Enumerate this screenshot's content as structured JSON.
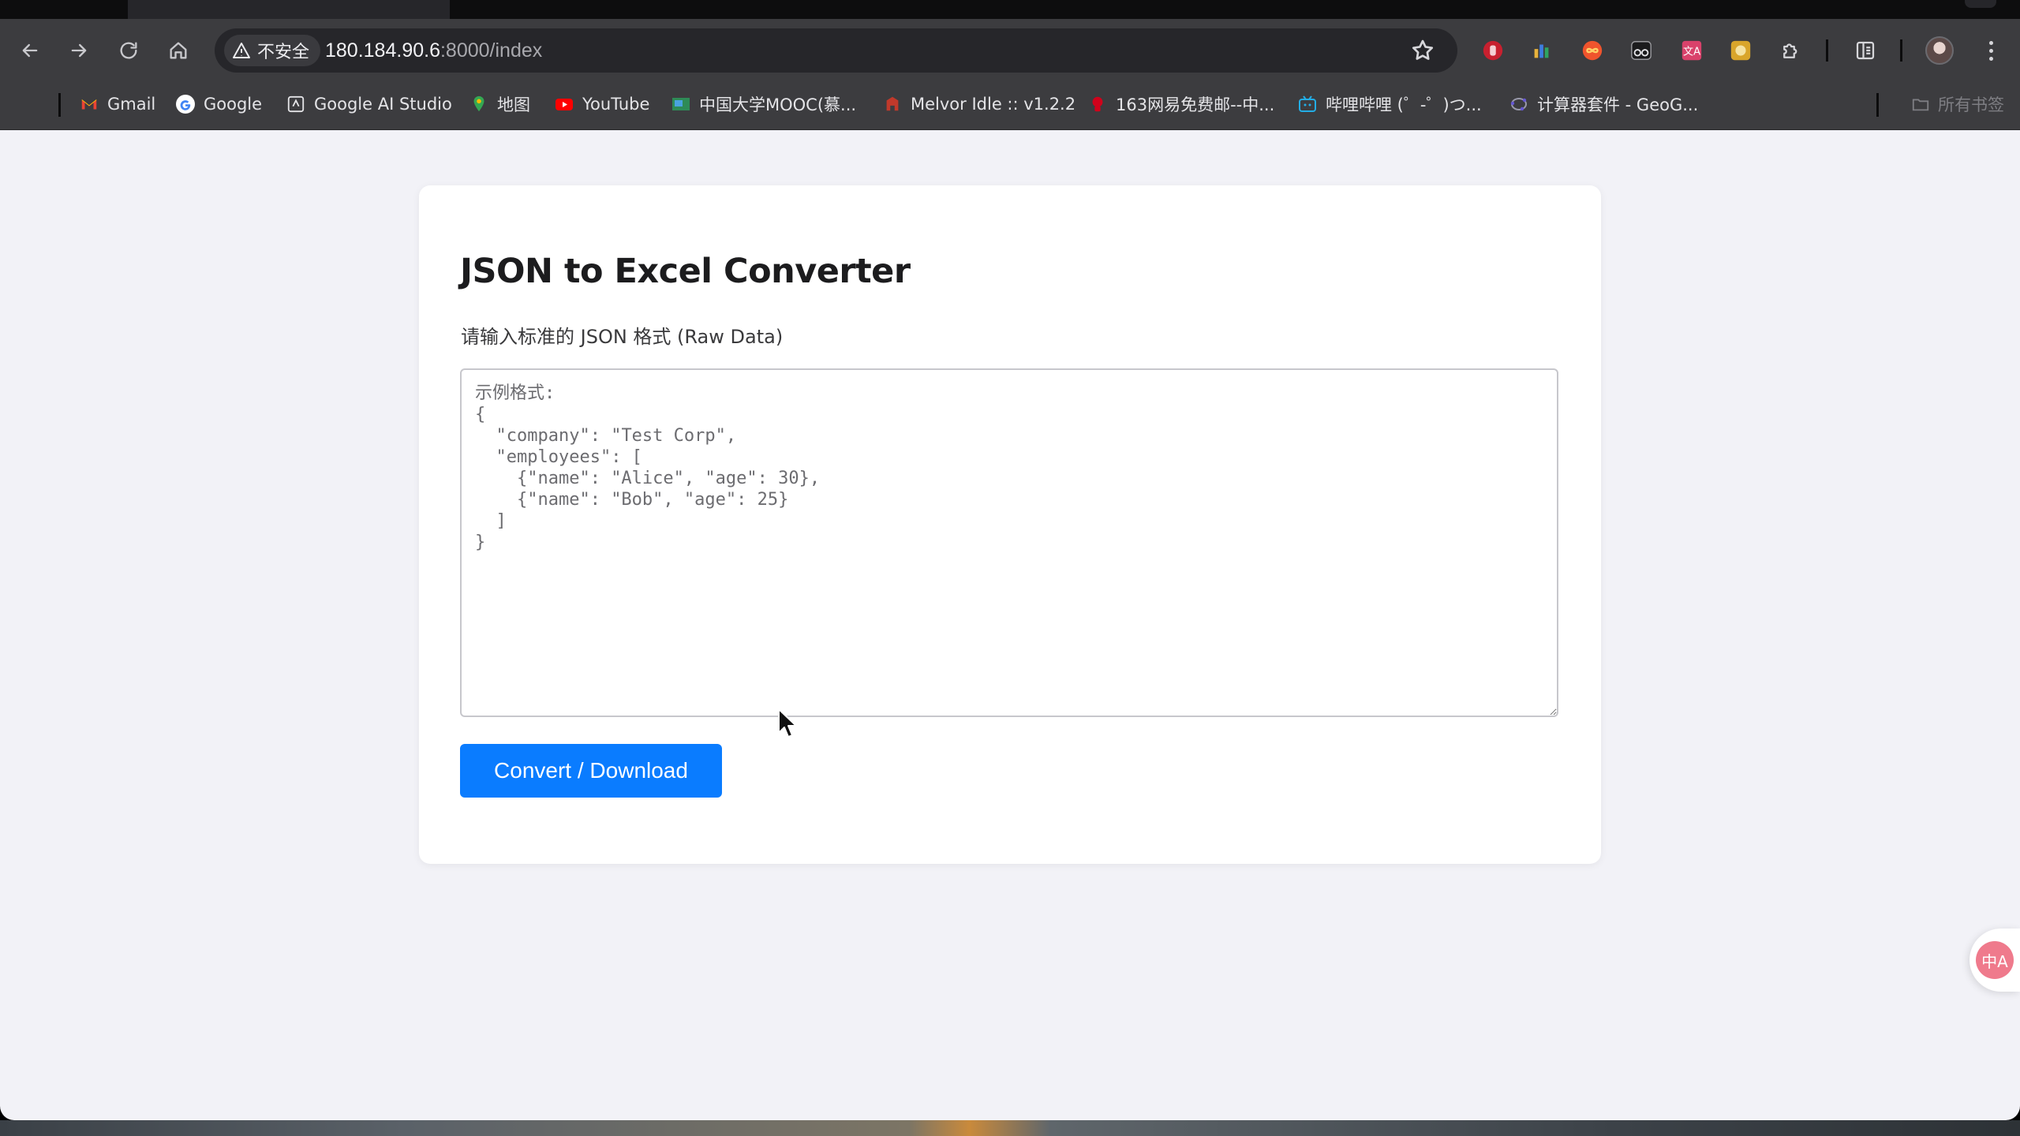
{
  "browser": {
    "security_label": "不安全",
    "url_host": "180.184.90.6",
    "url_rest": ":8000/index",
    "bookmarks": [
      {
        "label": "Gmail",
        "icon": "gmail-icon"
      },
      {
        "label": "Google",
        "icon": "google-icon"
      },
      {
        "label": "Google AI Studio",
        "icon": "ai-studio-icon"
      },
      {
        "label": "地图",
        "icon": "maps-pin-icon"
      },
      {
        "label": "YouTube",
        "icon": "youtube-icon"
      },
      {
        "label": "中国大学MOOC(慕...",
        "icon": "mooc-icon"
      },
      {
        "label": "Melvor Idle :: v1.2.2",
        "icon": "melvor-icon"
      },
      {
        "label": "163网易免费邮--中...",
        "icon": "netease-mail-icon"
      },
      {
        "label": "哔哩哔哩 (゜-゜)つ...",
        "icon": "bilibili-icon"
      },
      {
        "label": "计算器套件 - GeoG...",
        "icon": "geogebra-icon"
      }
    ],
    "all_bookmarks_label": "所有书签"
  },
  "page": {
    "title": "JSON to Excel Converter",
    "input_label": "请输入标准的 JSON 格式 (Raw Data)",
    "input_placeholder": "示例格式:\n{\n  \"company\": \"Test Corp\",\n  \"employees\": [\n    {\"name\": \"Alice\", \"age\": 30},\n    {\"name\": \"Bob\", \"age\": 25}\n  ]\n}",
    "button_label": "Convert / Download"
  },
  "translate_fab": {
    "label": "中A"
  },
  "colors": {
    "accent": "#0a7cff",
    "page_bg": "#f2f2f7",
    "toolbar_bg": "#3c3c3f"
  }
}
